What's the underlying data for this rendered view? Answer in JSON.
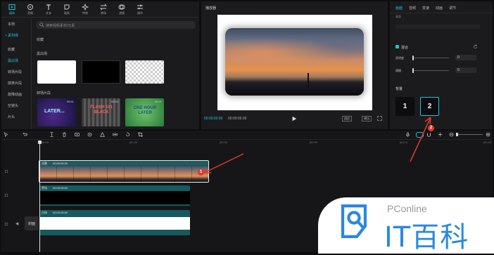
{
  "toolbar": {
    "items": [
      {
        "label": "媒体",
        "icon": "media-icon"
      },
      {
        "label": "音频",
        "icon": "audio-icon"
      },
      {
        "label": "文本",
        "icon": "text-icon"
      },
      {
        "label": "贴纸",
        "icon": "sticker-icon"
      },
      {
        "label": "特效",
        "icon": "effects-icon"
      },
      {
        "label": "转场",
        "icon": "transition-icon"
      },
      {
        "label": "滤镜",
        "icon": "filter-icon"
      },
      {
        "label": "调节",
        "icon": "adjust-icon"
      }
    ]
  },
  "sidebar": {
    "items": [
      "本地",
      "素材库",
      "收藏",
      "黑白场",
      "转场片段",
      "搞笑片段",
      "故障动画",
      "空镜头",
      "片头"
    ]
  },
  "media": {
    "search_placeholder": "搜索视频素材/元素",
    "section_favorites": "收藏",
    "section_bw": "黑白场",
    "section_transition": "转场片段",
    "thumb_texts": [
      "LATER...",
      "FLASH 101 BLACK",
      "ONE HOUR LATER"
    ],
    "thumb_durations": [
      "00:01",
      "00:01",
      "00:01"
    ]
  },
  "player": {
    "title": "播放器",
    "current_time": "00:00:00:00",
    "total_time": "00:00:05:00",
    "btn_fit": "适应",
    "btn_ratio": "原比"
  },
  "props": {
    "tabs": [
      "画面",
      "音频",
      "变速",
      "动画",
      "调节"
    ],
    "row_label_top": "画面",
    "blend_label": "混合",
    "opacity_label": "透明度",
    "opacity_value": "0",
    "opacity2_label": "模糊",
    "opacity2_value": "0",
    "style_label": "背景",
    "option1": "1",
    "option2": "2"
  },
  "timeline": {
    "ruler_marks": [
      "00:00",
      "|00:03",
      "|00:06",
      "|00:09",
      "|00:12",
      "|00:15"
    ],
    "tracks": [
      {
        "name": "风景",
        "duration": "00:00:05:00"
      },
      {
        "name": "黑场",
        "duration": "00:00:05:00"
      },
      {
        "name": "白场",
        "duration": "00:00:05:00"
      }
    ],
    "cover_label": "封面"
  },
  "annotations": {
    "marker1": "1",
    "marker2": "2"
  },
  "watermark": {
    "text1": "PConline",
    "text2": "IT百科"
  },
  "colors": {
    "accent": "#21c2d4",
    "panel": "#1b1b1e",
    "track_teal": "#165a5e",
    "annotation_red": "#e03a2f"
  }
}
